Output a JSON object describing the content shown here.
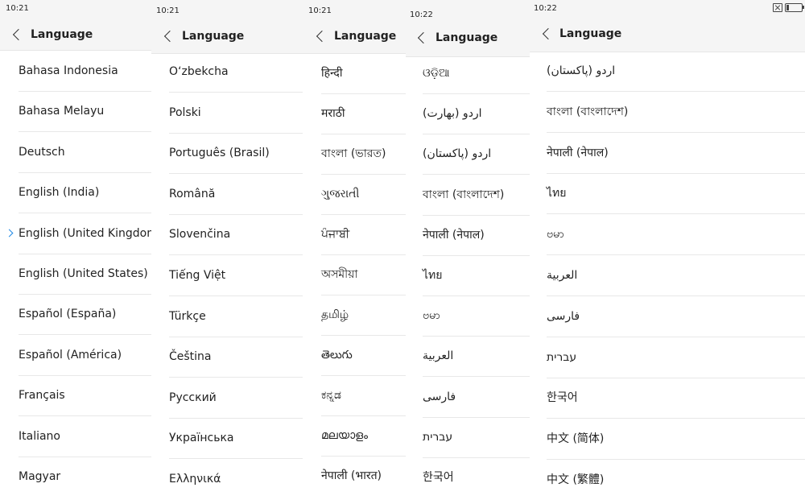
{
  "panels": [
    {
      "time": "10:21",
      "title": "Language",
      "selected_index": 4,
      "items": [
        "Bahasa Indonesia",
        "Bahasa Melayu",
        "Deutsch",
        "English (India)",
        "English (United Kingdom)",
        "English (United States)",
        "Español (España)",
        "Español (América)",
        "Français",
        "Italiano",
        "Magyar"
      ]
    },
    {
      "time": "10:21",
      "title": "Language",
      "items": [
        "O‘zbekcha",
        "Polski",
        "Português (Brasil)",
        "Română",
        "Slovenčina",
        "Tiếng Việt",
        "Türkçe",
        "Čeština",
        "Русский",
        "Українська",
        "Ελληνικά"
      ]
    },
    {
      "time": "10:21",
      "title": "Language",
      "items": [
        "हिन्दी",
        "मराठी",
        "বাংলা (ভারত)",
        "ગુજરાતી",
        "ਪੰਜਾਬੀ",
        "অসমীয়া",
        "தமிழ்",
        "తెలుగు",
        "ಕನ್ನಡ",
        "മലയാളം",
        "नेपाली (भारत)"
      ]
    },
    {
      "time": "10:22",
      "title": "Language",
      "items": [
        "ଓଡ଼ିଆ",
        "اردو (بھارت)",
        "اردو (پاکستان)",
        "বাংলা (বাংলাদেশ)",
        "नेपाली (नेपाल)",
        "ไทย",
        "ဗမာ",
        "العربية",
        "فارسی",
        "עברית",
        "한국어"
      ]
    },
    {
      "time": "10:22",
      "title": "Language",
      "items": [
        "اردو (پاکستان)",
        "বাংলা (বাংলাদেশ)",
        "नेपाली (नेपाल)",
        "ไทย",
        "ဗမာ",
        "العربية",
        "فارسی",
        "עברית",
        "한국어",
        "中文 (简体)",
        "中文 (繁體)"
      ]
    }
  ],
  "colors": {
    "accent": "#1e88e5",
    "header_bg": "#f5f5f5",
    "separator": "#e8e8e8"
  },
  "icons": {
    "back": "chevron-left-icon",
    "selected": "chevron-right-icon",
    "sim": "no-sim-icon",
    "battery": "battery-icon"
  }
}
